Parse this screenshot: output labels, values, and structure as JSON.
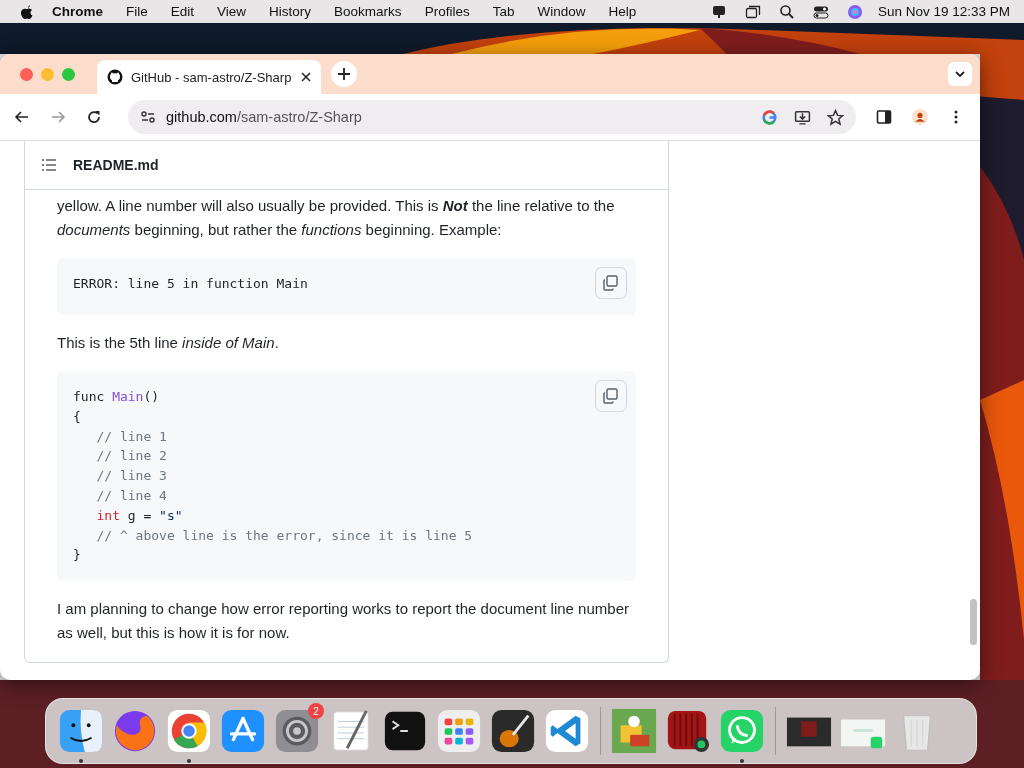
{
  "menu_bar": {
    "app": "Chrome",
    "items": [
      "File",
      "Edit",
      "View",
      "History",
      "Bookmarks",
      "Profiles",
      "Tab",
      "Window",
      "Help"
    ],
    "clock": "Sun Nov 19  12:33 PM"
  },
  "browser": {
    "tab": {
      "title": "GitHub - sam-astro/Z-Sharp",
      "selected": true
    },
    "address": {
      "host": "github.com",
      "path": "/sam-astro/Z-Sharp"
    }
  },
  "readme": {
    "title": "README.md",
    "blocks": [
      {
        "kind": "paragraph",
        "text": "yellow. A line number will also usually be provided. This is **Not** the line relative to the *documents* beginning, but rather the *functions* beginning. Example:"
      },
      {
        "kind": "code",
        "lines": [
          [
            {
              "text": "ERROR: line 5 in function Main",
              "kind": "plain"
            }
          ]
        ]
      },
      {
        "kind": "paragraph",
        "text": "This is the 5th line *inside of Main*."
      },
      {
        "kind": "code",
        "lines": [
          [
            {
              "text": "func ",
              "kind": "plain"
            },
            {
              "text": "Main",
              "kind": "func"
            },
            {
              "text": "()",
              "kind": "plain"
            }
          ],
          [
            {
              "text": "{",
              "kind": "plain"
            }
          ],
          [
            {
              "text": "   // line 1",
              "kind": "comment"
            }
          ],
          [
            {
              "text": "   // line 2",
              "kind": "comment"
            }
          ],
          [
            {
              "text": "   // line 3",
              "kind": "comment"
            }
          ],
          [
            {
              "text": "   // line 4",
              "kind": "comment"
            }
          ],
          [
            {
              "text": "   int",
              "kind": "keyword"
            },
            {
              "text": " g = ",
              "kind": "plain"
            },
            {
              "text": "\"s\"",
              "kind": "string"
            }
          ],
          [
            {
              "text": "   // ^ above line is the error, since it is line 5",
              "kind": "comment"
            }
          ],
          [
            {
              "text": "}",
              "kind": "plain"
            }
          ]
        ]
      },
      {
        "kind": "paragraph",
        "text": "I am planning to change how error reporting works to report the document line number as well, but this is how it is for now."
      }
    ]
  },
  "dock": {
    "items": [
      {
        "kind": "finder",
        "running": true
      },
      {
        "kind": "firefox",
        "running": false
      },
      {
        "kind": "chrome",
        "running": true
      },
      {
        "kind": "appstore",
        "running": false
      },
      {
        "kind": "settings",
        "running": false,
        "badge": "2"
      },
      {
        "kind": "textedit",
        "running": false
      },
      {
        "kind": "terminal",
        "running": false
      },
      {
        "kind": "launchpad",
        "running": false
      },
      {
        "kind": "guitar",
        "running": false
      },
      {
        "kind": "vscode",
        "running": false
      },
      {
        "kind": "separator"
      },
      {
        "kind": "game",
        "running": false
      },
      {
        "kind": "camera",
        "running": false
      },
      {
        "kind": "whatsapp",
        "running": true
      },
      {
        "kind": "separator"
      },
      {
        "kind": "window",
        "running": false
      },
      {
        "kind": "window2",
        "running": false
      },
      {
        "kind": "trash",
        "running": false
      }
    ]
  }
}
